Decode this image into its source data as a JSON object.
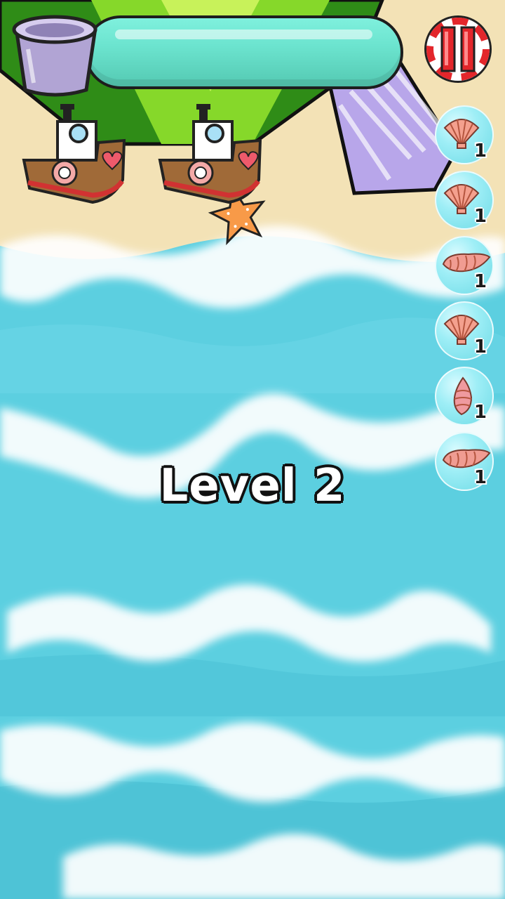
{
  "level": {
    "title": "Level 2"
  },
  "hud": {
    "progress_fraction": 0.0,
    "bucket_icon": "bucket-icon",
    "pause_icon": "pause-icon"
  },
  "shells": [
    {
      "kind": "scallop",
      "icon": "scallop-shell-icon",
      "count": "1"
    },
    {
      "kind": "scallop",
      "icon": "scallop-shell-icon",
      "count": "1"
    },
    {
      "kind": "conch",
      "icon": "conch-shell-icon",
      "count": "1"
    },
    {
      "kind": "scallop",
      "icon": "scallop-shell-icon",
      "count": "1"
    },
    {
      "kind": "spiral",
      "icon": "spiral-shell-icon",
      "count": "1"
    },
    {
      "kind": "conch",
      "icon": "conch-shell-icon",
      "count": "1"
    }
  ],
  "colors": {
    "sea": "#5ccfe0",
    "sand": "#f3e2b6",
    "progress": "#6ce4cf",
    "grass": "#86d82a",
    "pause_red": "#e3262b"
  }
}
